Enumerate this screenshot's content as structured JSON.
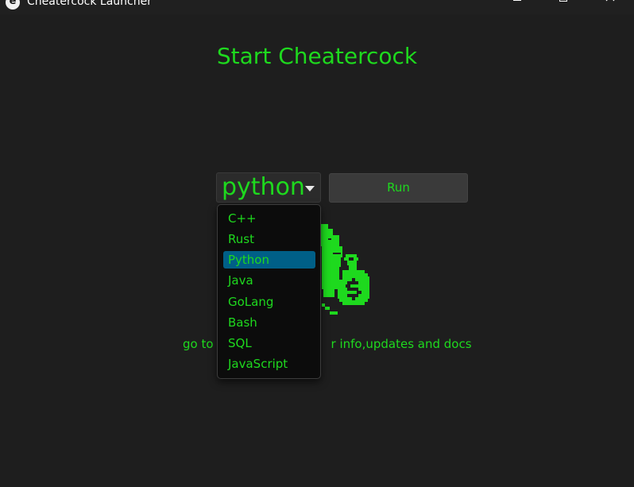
{
  "window": {
    "title": "Cheatercock Launcher",
    "app_icon_letter": "e"
  },
  "main": {
    "heading": "Start Cheatercock",
    "language_select": {
      "value": "python",
      "options": [
        "C++",
        "Rust",
        "Python",
        "Java",
        "GoLang",
        "Bash",
        "SQL",
        "JavaScript"
      ],
      "highlighted": "Python",
      "expanded": true
    },
    "run_label": "Run",
    "info_text_left": "go to",
    "info_text_right": "r info,updates and docs"
  },
  "colors": {
    "background": "#1e1e1e",
    "accent_green": "#1ed91e",
    "highlight": "#005f87"
  },
  "icons": [
    "app-icon",
    "minimize-icon",
    "maximize-icon",
    "close-icon",
    "dropdown-arrow-icon",
    "money-bag-logo"
  ]
}
